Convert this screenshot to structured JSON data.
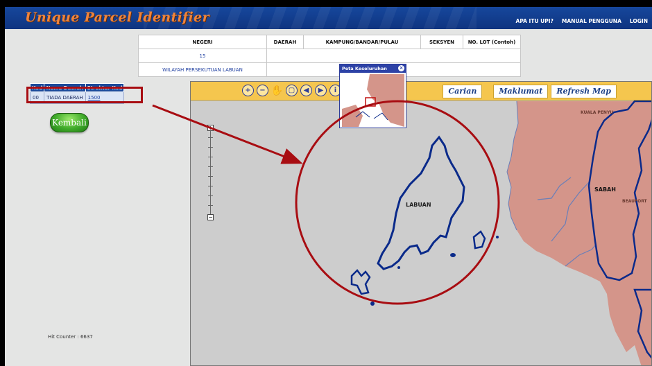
{
  "app": {
    "brand": "Unique Parcel Identifier",
    "nav": [
      "APA ITU UPI?",
      "MANUAL PENGGUNA",
      "LOGIN"
    ]
  },
  "info_table": {
    "headers": [
      "NEGERI",
      "DAERAH",
      "KAMPUNG/BANDAR/PULAU",
      "SEKSYEN",
      "NO. LOT (Contoh)"
    ],
    "row1": [
      "15",
      "",
      "",
      "",
      ""
    ],
    "row2": [
      "WILAYAH PERSEKUTUAN LABUAN",
      "",
      "",
      "",
      ""
    ]
  },
  "kod_table": {
    "headers": [
      "Kod",
      "Nama Daerah",
      "Struktur Kod"
    ],
    "rows": [
      [
        "00",
        "TIADA DAERAH",
        "1500"
      ]
    ]
  },
  "kembali_label": "Kembali",
  "hit_counter": "Hit Counter : 6637",
  "map": {
    "buttons": [
      "Carian",
      "Maklumat",
      "Refresh Map"
    ],
    "tools": [
      "zoom-in-icon",
      "zoom-out-icon",
      "pan-hand-icon",
      "zoom-box-icon",
      "previous-extent-icon",
      "next-extent-icon",
      "info-icon"
    ],
    "labels": {
      "island": "LABUAN",
      "state": "SABAH",
      "town1": "KUALA PENYU",
      "town2": "BEAUFORT"
    },
    "colors": {
      "land": "#d4958a",
      "coast": "#0a2a8a",
      "sea": "#cdcdcd",
      "toolbar": "#f5c64e",
      "annotation": "#a80d12"
    }
  },
  "overview": {
    "title": "Peta Keseluruhan"
  }
}
